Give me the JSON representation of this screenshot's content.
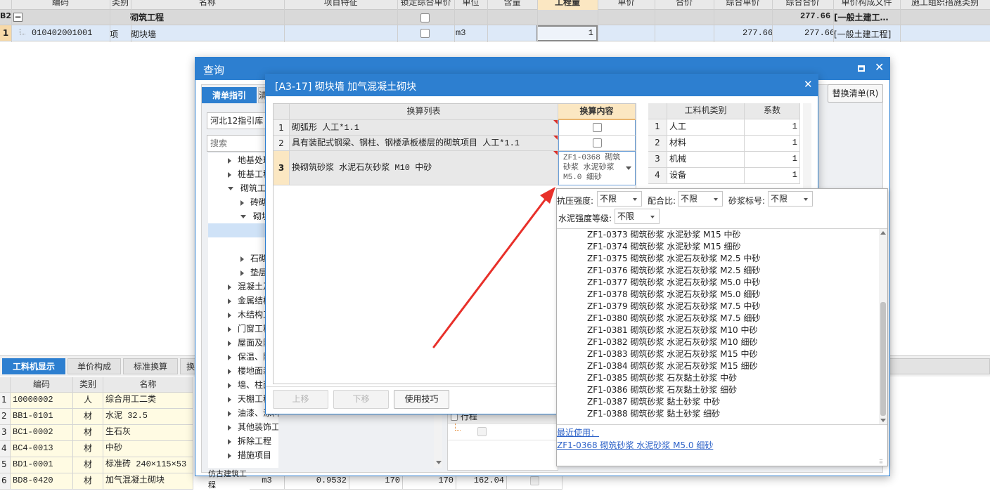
{
  "top_table": {
    "headers": [
      "编码",
      "类别",
      "名称",
      "项目特征",
      "锁定综合单价",
      "单位",
      "含量",
      "工程量",
      "单价",
      "合价",
      "综合单价",
      "综合合价",
      "单价构成文件",
      "施工组织措施类别"
    ],
    "group_row": {
      "num": "B2",
      "collapse": "−",
      "name": "砌筑工程",
      "total": "277.66",
      "file": "[一般土建工…"
    },
    "item_row": {
      "num": "1",
      "code": "010402001001",
      "type": "项",
      "name": "砌块墙",
      "unit": "m3",
      "qty": "1",
      "comp_price": "277.66",
      "comp_total": "277.66",
      "file": "[一般土建工程]"
    }
  },
  "bottom_panel": {
    "tabs": [
      "工料机显示",
      "单价构成",
      "标准换算",
      "换"
    ],
    "headers": [
      "编码",
      "类别",
      "名称"
    ],
    "rows": [
      {
        "n": "1",
        "code": "10000002",
        "type": "人",
        "name": "综合用工二类"
      },
      {
        "n": "2",
        "code": "BB1-0101",
        "type": "材",
        "name": "水泥 32.5"
      },
      {
        "n": "3",
        "code": "BC1-0002",
        "type": "材",
        "name": "生石灰"
      },
      {
        "n": "4",
        "code": "BC4-0013",
        "type": "材",
        "name": "中砂"
      },
      {
        "n": "5",
        "code": "BD1-0001",
        "type": "材",
        "name": "标准砖 240×115×53"
      },
      {
        "n": "6",
        "code": "BD8-0420",
        "type": "材",
        "name": "加气混凝土砌块",
        "unit": "m3",
        "v1": "0.9532",
        "v2": "170",
        "v3": "170",
        "v4": "162.04"
      }
    ]
  },
  "query_dialog": {
    "title": "查询",
    "tabs": [
      "清单指引",
      "清"
    ],
    "library": "河北12指引库",
    "search_placeholder": "搜索",
    "replace_button": "替换清单(R)",
    "tree": [
      {
        "label": "地基处理",
        "level": 0,
        "exp": "r"
      },
      {
        "label": "桩基工程",
        "level": 0,
        "exp": "r"
      },
      {
        "label": "砌筑工程",
        "level": 0,
        "exp": "d"
      },
      {
        "label": "砖砌体",
        "level": 1,
        "exp": "r"
      },
      {
        "label": "砌块砌体",
        "level": 1,
        "exp": "d"
      },
      {
        "label": "",
        "level": 2,
        "exp": ""
      },
      {
        "label": "",
        "level": 2,
        "exp": ""
      },
      {
        "label": "石砌体",
        "level": 1,
        "exp": "r"
      },
      {
        "label": "垫层",
        "level": 1,
        "exp": "r"
      },
      {
        "label": "混凝土及钢筋",
        "level": 0,
        "exp": "r"
      },
      {
        "label": "金属结构",
        "level": 0,
        "exp": "r"
      },
      {
        "label": "木结构工程",
        "level": 0,
        "exp": "r"
      },
      {
        "label": "门窗工程",
        "level": 0,
        "exp": "r"
      },
      {
        "label": "屋面及防水",
        "level": 0,
        "exp": "r"
      },
      {
        "label": "保温、隔热",
        "level": 0,
        "exp": "r"
      },
      {
        "label": "楼地面装饰",
        "level": 0,
        "exp": "r"
      },
      {
        "label": "墙、柱面",
        "level": 0,
        "exp": "r"
      },
      {
        "label": "天棚工程",
        "level": 0,
        "exp": "r"
      },
      {
        "label": "油漆、涂料、裱糊工程",
        "level": 0,
        "exp": "r"
      },
      {
        "label": "其他装饰工程",
        "level": 0,
        "exp": "r"
      },
      {
        "label": "拆除工程",
        "level": 0,
        "exp": "r"
      },
      {
        "label": "措施项目",
        "level": 0,
        "exp": "r"
      },
      {
        "label": "仿古建筑工程",
        "level": -1,
        "exp": ""
      }
    ],
    "sub_panel_title": "行程"
  },
  "convert_dialog": {
    "title": "[A3-17] 砌块墙 加气混凝土砌块",
    "headers": {
      "list": "换算列表",
      "content": "换算内容"
    },
    "rows": [
      {
        "n": "1",
        "text": "砌弧形 人工*1.1"
      },
      {
        "n": "2",
        "text": "具有装配式钢梁、钢柱、钢楼承板楼层的砌筑项目 人工*1.1"
      },
      {
        "n": "3",
        "text": "换砌筑砂浆 水泥石灰砂浆 M10 中砂",
        "content": "ZF1-0368 砌筑砂浆 水泥砂浆 M5.0 细砂"
      }
    ],
    "buttons": [
      "上移",
      "下移",
      "使用技巧"
    ],
    "coef_table": {
      "headers": [
        "工料机类别",
        "系数"
      ],
      "rows": [
        {
          "n": "1",
          "cat": "人工",
          "v": "1"
        },
        {
          "n": "2",
          "cat": "材料",
          "v": "1"
        },
        {
          "n": "3",
          "cat": "机械",
          "v": "1"
        },
        {
          "n": "4",
          "cat": "设备",
          "v": "1"
        }
      ]
    }
  },
  "dropdown": {
    "filters": [
      {
        "label": "抗压强度:",
        "value": "不限"
      },
      {
        "label": "配合比:",
        "value": "不限"
      },
      {
        "label": "砂浆标号:",
        "value": "不限"
      },
      {
        "label": "水泥强度等级:",
        "value": "不限"
      }
    ],
    "items": [
      "ZF1-0373  砌筑砂浆 水泥砂浆 M15 中砂",
      "ZF1-0374  砌筑砂浆 水泥砂浆 M15 细砂",
      "ZF1-0375  砌筑砂浆 水泥石灰砂浆 M2.5 中砂",
      "ZF1-0376  砌筑砂浆 水泥石灰砂浆 M2.5 细砂",
      "ZF1-0377  砌筑砂浆 水泥石灰砂浆 M5.0 中砂",
      "ZF1-0378  砌筑砂浆 水泥石灰砂浆 M5.0 细砂",
      "ZF1-0379  砌筑砂浆 水泥石灰砂浆 M7.5 中砂",
      "ZF1-0380  砌筑砂浆 水泥石灰砂浆 M7.5 细砂",
      "ZF1-0381  砌筑砂浆 水泥石灰砂浆 M10 中砂",
      "ZF1-0382  砌筑砂浆 水泥石灰砂浆 M10 细砂",
      "ZF1-0383  砌筑砂浆 水泥石灰砂浆 M15 中砂",
      "ZF1-0384  砌筑砂浆 水泥石灰砂浆 M15 细砂",
      "ZF1-0385  砌筑砂浆 石灰黏土砂浆 中砂",
      "ZF1-0386  砌筑砂浆 石灰黏土砂浆 细砂",
      "ZF1-0387  砌筑砂浆 黏土砂浆 中砂",
      "ZF1-0388  砌筑砂浆 黏土砂浆 细砂"
    ],
    "recent_label": "最近使用：",
    "recent_item": "ZF1-0368 砌筑砂浆 水泥砂浆 M5.0 细砂"
  },
  "colors": {
    "accent": "#2d7fd0",
    "header_bg": "#e9e9e9",
    "row_highlight": "#dde9f8",
    "arrow": "#e8302a"
  }
}
